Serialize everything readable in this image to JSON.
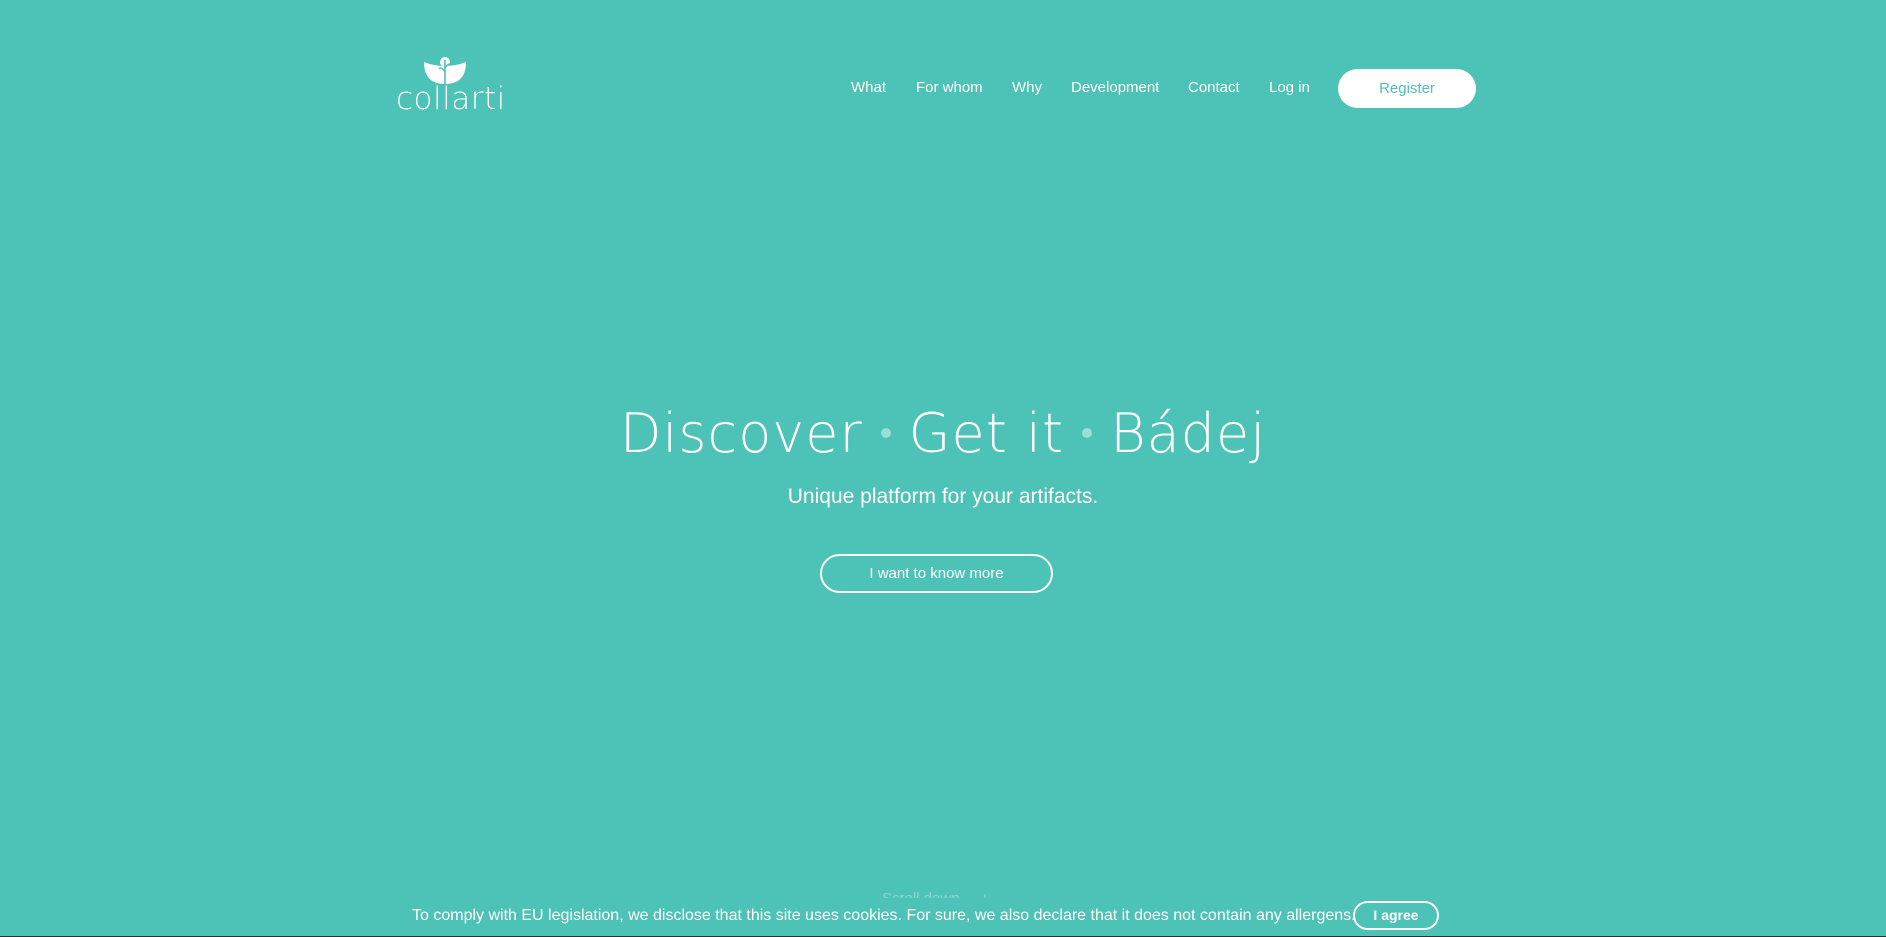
{
  "brand": {
    "logo_text": "collarti",
    "logo_icon": "collarti-flower-logo-icon"
  },
  "nav": {
    "items": [
      {
        "label": "What"
      },
      {
        "label": "For whom"
      },
      {
        "label": "Why"
      },
      {
        "label": "Development"
      },
      {
        "label": "Contact"
      },
      {
        "label": "Log in"
      }
    ],
    "register_label": "Register"
  },
  "hero": {
    "title_words": [
      "Discover",
      "Get it",
      "Bádej"
    ],
    "subtitle": "Unique platform for your artifacts.",
    "cta_label": "I want to know more"
  },
  "scroll": {
    "label": "Scroll down",
    "icon": "arrow-down-icon"
  },
  "cookie": {
    "text": "To comply with EU legislation, we disclose that this site uses cookies. For sure, we also declare that it does not contain any allergens.",
    "agree_label": "I agree"
  },
  "colors": {
    "background": "#4dc2b7",
    "foreground": "#ffffff",
    "border_dark": "#2f2f2f"
  }
}
